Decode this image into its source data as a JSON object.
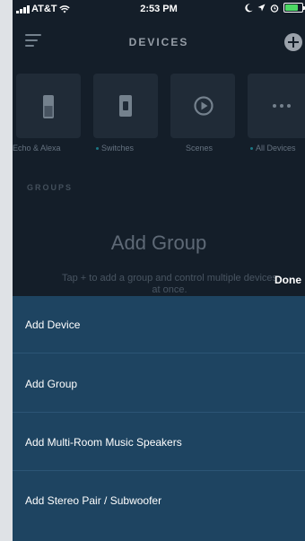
{
  "status_bar": {
    "carrier": "AT&T",
    "time": "2:53 PM",
    "battery_level": 0.75,
    "battery_color": "#4cd964"
  },
  "header": {
    "title": "DEVICES",
    "menu_icon": "hamburger-menu-icon",
    "add_icon": "plus-circle-icon"
  },
  "tiles": [
    {
      "label": "Echo & Alexa",
      "icon": "echo-speaker-icon",
      "dot": false
    },
    {
      "label": "Switches",
      "icon": "switch-icon",
      "dot": true
    },
    {
      "label": "Scenes",
      "icon": "scenes-play-icon",
      "dot": false
    },
    {
      "label": "All Devices",
      "icon": "more-dots-icon",
      "dot": true
    }
  ],
  "groups": {
    "heading": "GROUPS",
    "empty_title": "Add Group",
    "empty_subtitle": "Tap + to add a group and control multiple devices at once."
  },
  "done_label": "Done",
  "sheet": {
    "items": [
      {
        "label": "Add Device"
      },
      {
        "label": "Add Group"
      },
      {
        "label": "Add Multi-Room Music Speakers"
      },
      {
        "label": "Add Stereo Pair / Subwoofer"
      }
    ]
  },
  "colors": {
    "background": "#141e29",
    "tile_bg": "#25303d",
    "sheet_bg": "#1e4461",
    "accent": "#1f9aa8"
  }
}
